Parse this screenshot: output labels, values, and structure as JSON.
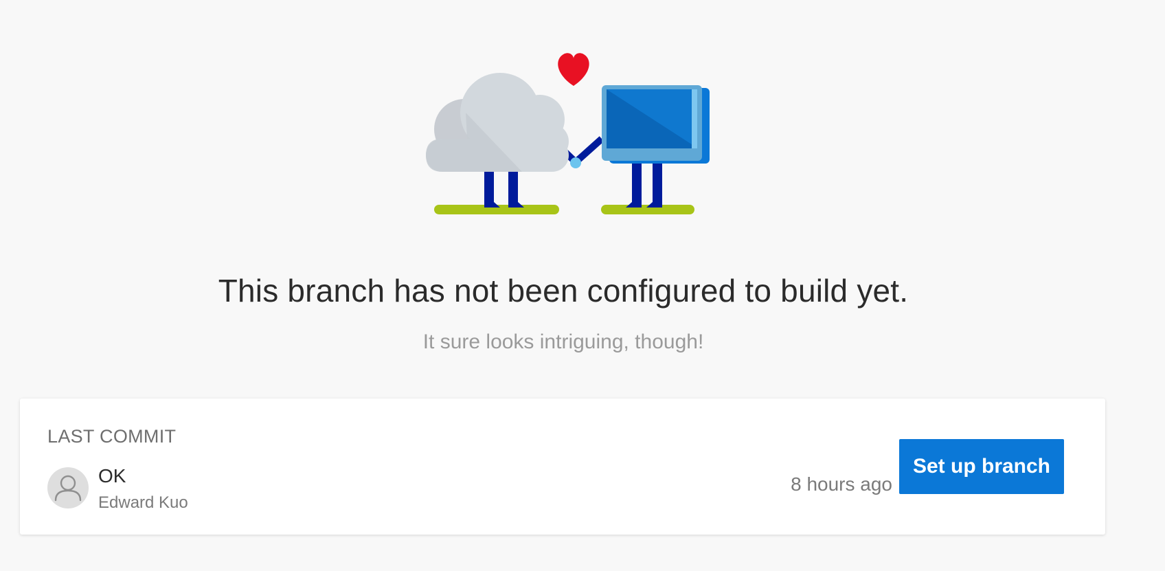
{
  "empty_state": {
    "illustration_icon": "cloud-and-computer-holding-hands-icon",
    "title": "This branch has not been configured to build yet.",
    "subtitle": "It sure looks intriguing, though!"
  },
  "last_commit": {
    "label": "LAST COMMIT",
    "avatar_icon": "user-avatar-icon",
    "message": "OK",
    "author": "Edward Kuo",
    "time": "8 hours ago"
  },
  "actions": {
    "setup_branch_label": "Set up branch"
  },
  "colors": {
    "accent": "#0b78d7",
    "heart": "#e81123",
    "ground": "#a8c418",
    "legs": "#001b9b",
    "background": "#f8f8f8"
  }
}
